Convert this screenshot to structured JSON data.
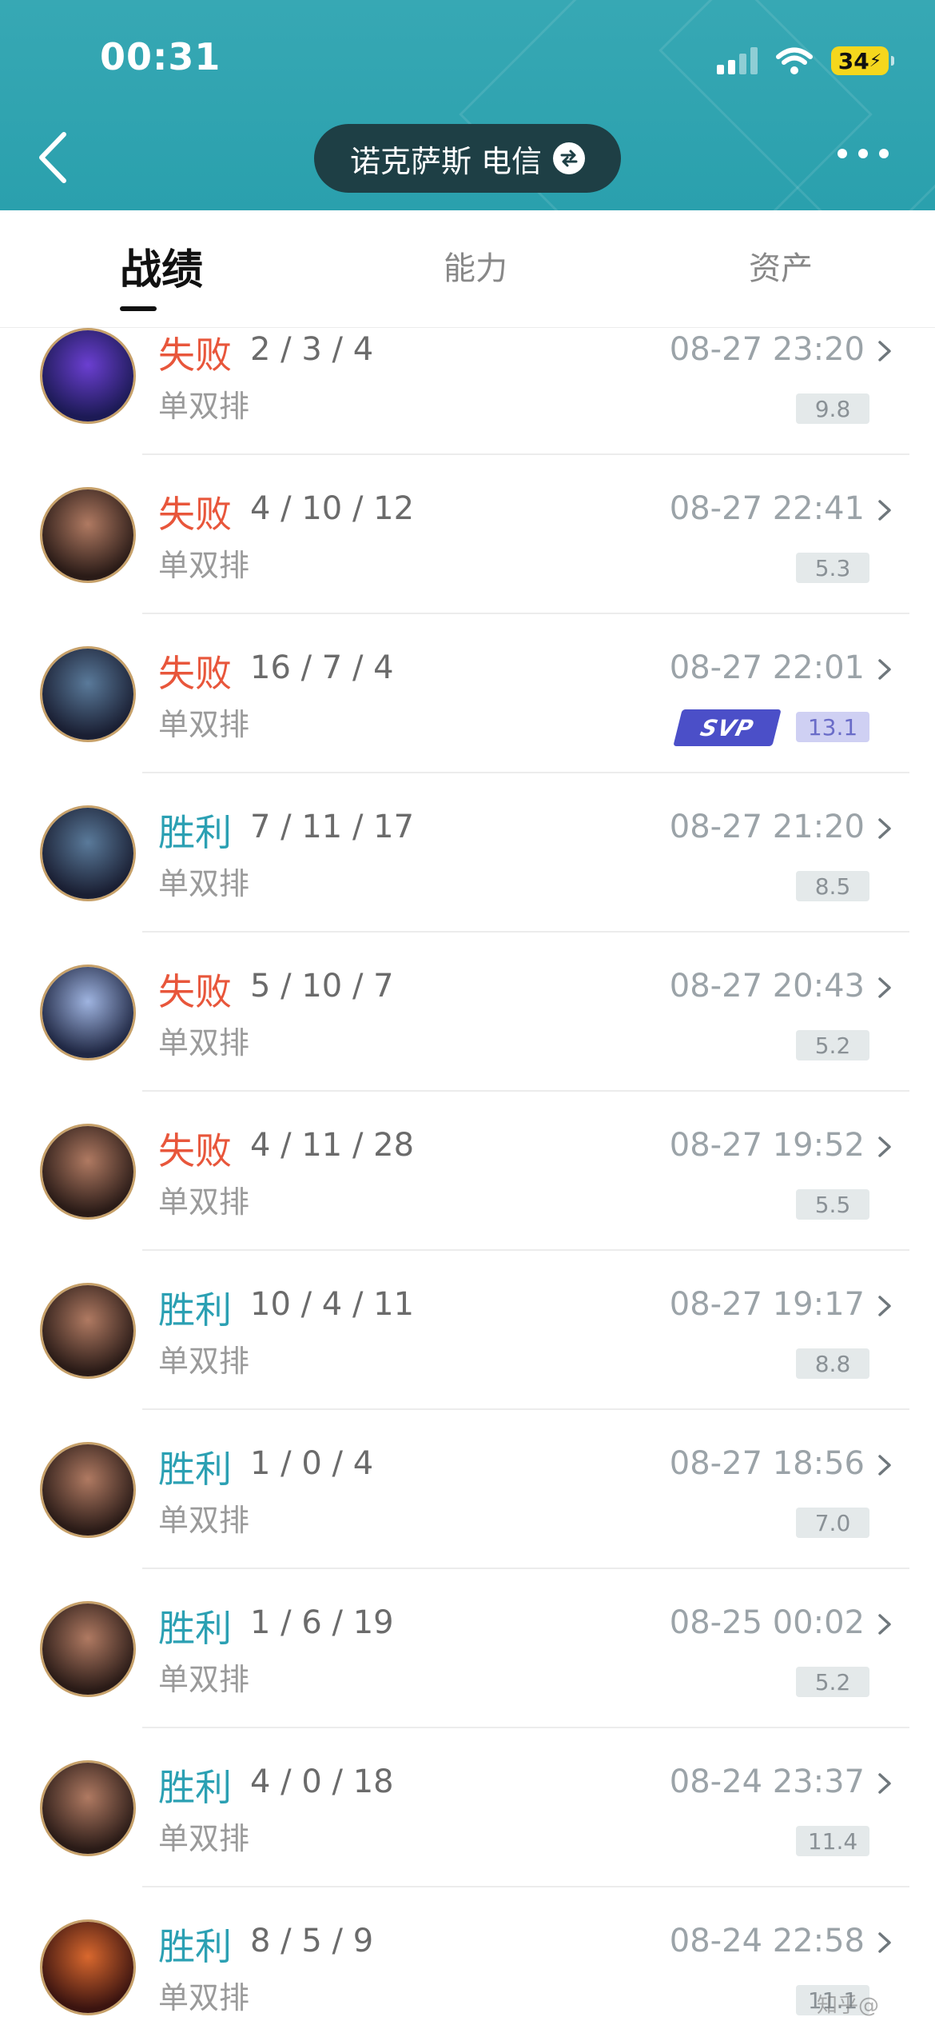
{
  "status": {
    "time": "00:31",
    "battery": "34"
  },
  "header": {
    "server": "诺克萨斯 电信"
  },
  "tabs": [
    {
      "label": "战绩",
      "active": true
    },
    {
      "label": "能力",
      "active": false
    },
    {
      "label": "资产",
      "active": false
    }
  ],
  "matches": [
    {
      "result": "失败",
      "outcome": "lose",
      "kda": "2 / 3 / 4",
      "mode": "单双排",
      "time": "08-27 23:20",
      "score": "9.8",
      "svp": false,
      "avatar_icon": "champion-avatar-purple-icon"
    },
    {
      "result": "失败",
      "outcome": "lose",
      "kda": "4 / 10 / 12",
      "mode": "单双排",
      "time": "08-27 22:41",
      "score": "5.3",
      "svp": false,
      "avatar_icon": "champion-avatar-swain-icon"
    },
    {
      "result": "失败",
      "outcome": "lose",
      "kda": "16 / 7 / 4",
      "mode": "单双排",
      "time": "08-27 22:01",
      "score": "13.1",
      "svp": true,
      "badge": "SVP",
      "avatar_icon": "champion-avatar-kayn-icon"
    },
    {
      "result": "胜利",
      "outcome": "win",
      "kda": "7 / 11 / 17",
      "mode": "单双排",
      "time": "08-27 21:20",
      "score": "8.5",
      "svp": false,
      "avatar_icon": "champion-avatar-kayn-icon"
    },
    {
      "result": "失败",
      "outcome": "lose",
      "kda": "5 / 10 / 7",
      "mode": "单双排",
      "time": "08-27 20:43",
      "score": "5.2",
      "svp": false,
      "avatar_icon": "champion-avatar-talon-icon"
    },
    {
      "result": "失败",
      "outcome": "lose",
      "kda": "4 / 11 / 28",
      "mode": "单双排",
      "time": "08-27 19:52",
      "score": "5.5",
      "svp": false,
      "avatar_icon": "champion-avatar-swain-icon"
    },
    {
      "result": "胜利",
      "outcome": "win",
      "kda": "10 / 4 / 11",
      "mode": "单双排",
      "time": "08-27 19:17",
      "score": "8.8",
      "svp": false,
      "avatar_icon": "champion-avatar-swain-icon"
    },
    {
      "result": "胜利",
      "outcome": "win",
      "kda": "1 / 0 / 4",
      "mode": "单双排",
      "time": "08-27 18:56",
      "score": "7.0",
      "svp": false,
      "avatar_icon": "champion-avatar-swain-icon"
    },
    {
      "result": "胜利",
      "outcome": "win",
      "kda": "1 / 6 / 19",
      "mode": "单双排",
      "time": "08-25 00:02",
      "score": "5.2",
      "svp": false,
      "avatar_icon": "champion-avatar-swain-icon"
    },
    {
      "result": "胜利",
      "outcome": "win",
      "kda": "4 / 0 / 18",
      "mode": "单双排",
      "time": "08-24 23:37",
      "score": "11.4",
      "svp": false,
      "avatar_icon": "champion-avatar-swain-icon"
    },
    {
      "result": "胜利",
      "outcome": "win",
      "kda": "8 / 5 / 9",
      "mode": "单双排",
      "time": "08-24 22:58",
      "score": "11.1",
      "svp": false,
      "avatar_icon": "champion-avatar-miss-fortune-icon"
    }
  ],
  "colors": {
    "header": "#2aa0ad",
    "lose": "#e8563b",
    "win": "#2ba0b3",
    "svp": "#4b4fc8"
  }
}
